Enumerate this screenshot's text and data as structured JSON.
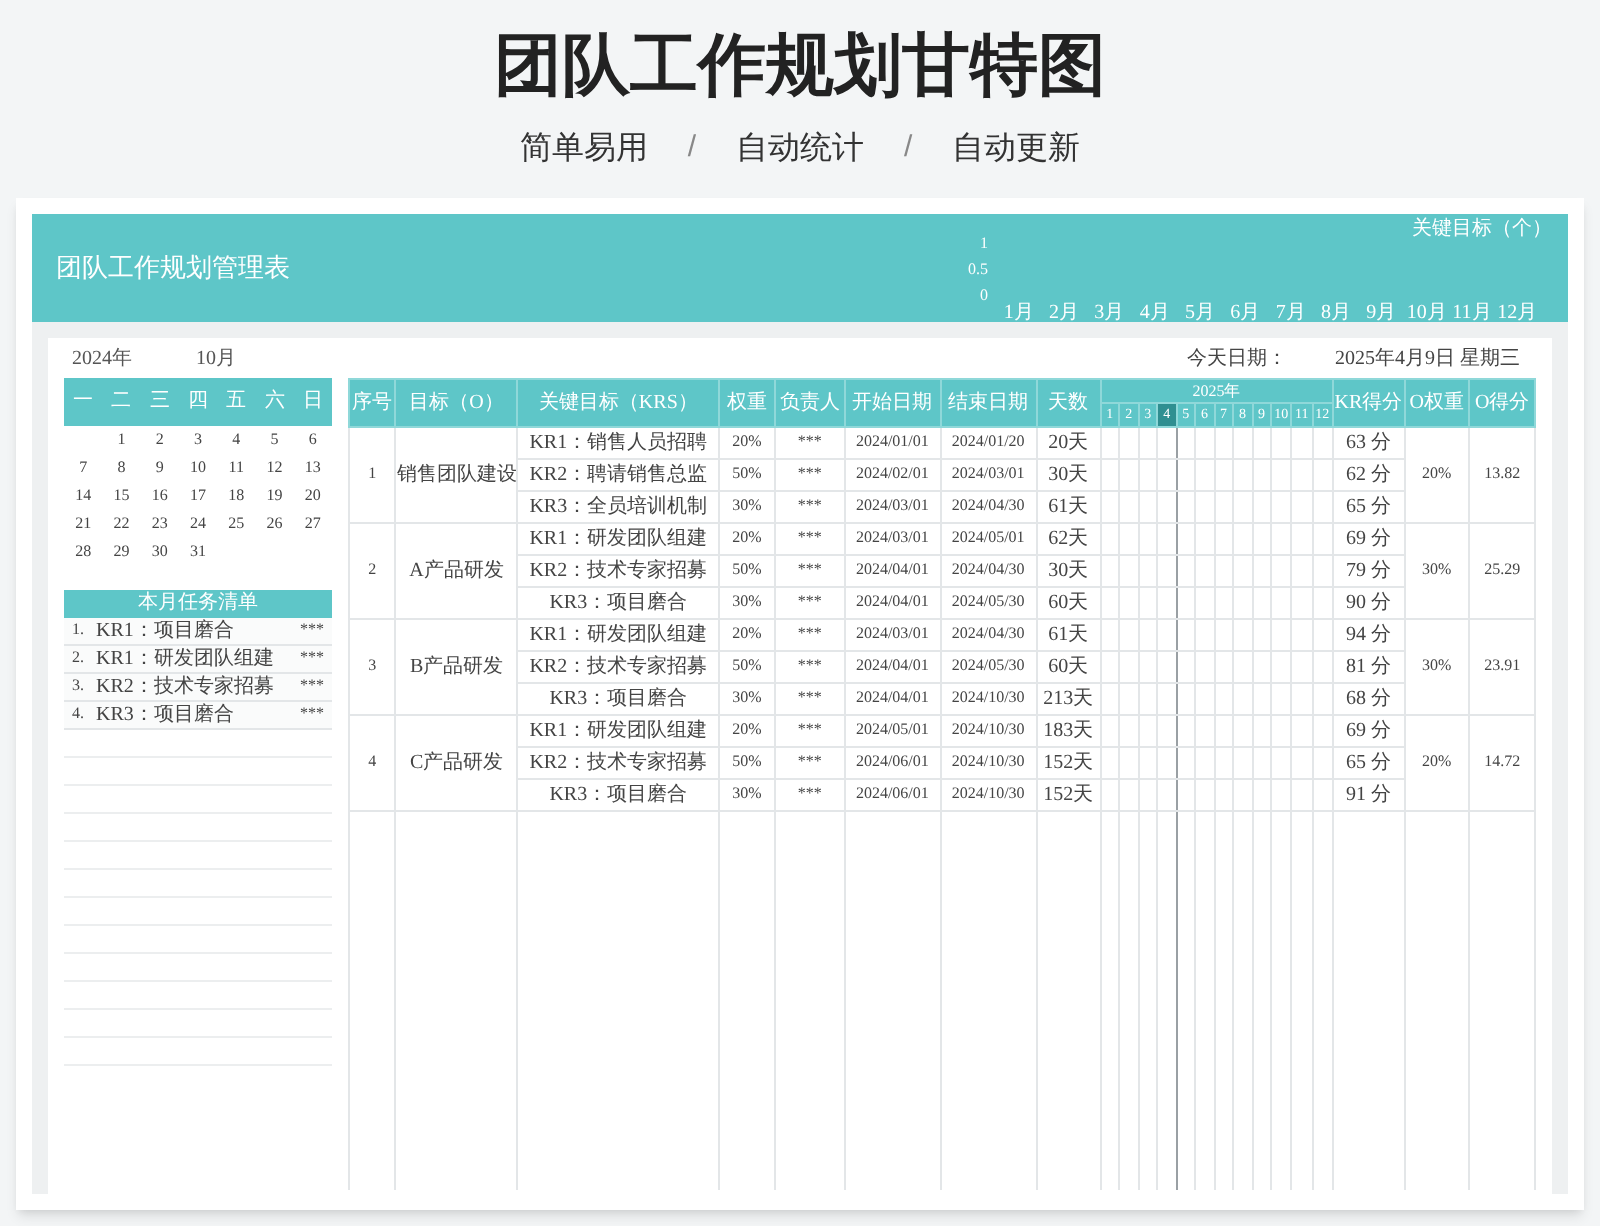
{
  "page_title": "团队工作规划甘特图",
  "subtitle": [
    {
      "kind": "text",
      "text": "简单易用"
    },
    {
      "kind": "sep",
      "text": "/"
    },
    {
      "kind": "text",
      "text": "自动统计"
    },
    {
      "kind": "sep",
      "text": "/"
    },
    {
      "kind": "text",
      "text": "自动更新"
    }
  ],
  "sheet": {
    "title": "团队工作规划管理表",
    "chart_data": {
      "type": "line",
      "title": "关键目标（个）",
      "categories": [
        "1月",
        "2月",
        "3月",
        "4月",
        "5月",
        "6月",
        "7月",
        "8月",
        "9月",
        "10月",
        "11月",
        "12月"
      ],
      "ylim": [
        0,
        1
      ],
      "yticks": [
        0,
        0.5,
        1
      ]
    }
  },
  "calendar": {
    "year": "2024年",
    "month": "10月",
    "weekdays": [
      "一",
      "二",
      "三",
      "四",
      "五",
      "六",
      "日"
    ],
    "weeks": [
      [
        "1",
        "2",
        "3",
        "4",
        "5",
        "6"
      ],
      [
        "7",
        "8",
        "9",
        "10",
        "11",
        "12",
        "13"
      ],
      [
        "14",
        "15",
        "16",
        "17",
        "18",
        "19",
        "20"
      ],
      [
        "21",
        "22",
        "23",
        "24",
        "25",
        "26",
        "27"
      ],
      [
        "28",
        "29",
        "30",
        "31"
      ]
    ]
  },
  "todo": {
    "title": "本月任务清单",
    "items": [
      {
        "index": "1.",
        "text": "KR1：项目磨合",
        "owner": "***"
      },
      {
        "index": "2.",
        "text": "KR1：研发团队组建",
        "owner": "***"
      },
      {
        "index": "3.",
        "text": "KR2：技术专家招募",
        "owner": "***"
      },
      {
        "index": "4.",
        "text": "KR3：项目磨合",
        "owner": "***"
      }
    ]
  },
  "today": {
    "label": "今天日期：",
    "value": "2025年4月9日 星期三"
  },
  "table": {
    "columns_left": [
      "序号",
      "目标（O）",
      "关键目标（KRS）",
      "权重",
      "负责人",
      "开始日期",
      "结束日期",
      "天数"
    ],
    "gantt": {
      "year": "2025年",
      "months": [
        {
          "label": "1",
          "selected": false
        },
        {
          "label": "2",
          "selected": false
        },
        {
          "label": "3",
          "selected": false
        },
        {
          "label": "4",
          "selected": true
        },
        {
          "label": "5",
          "selected": false
        },
        {
          "label": "6",
          "selected": false
        },
        {
          "label": "7",
          "selected": false
        },
        {
          "label": "8",
          "selected": false
        },
        {
          "label": "9",
          "selected": false
        },
        {
          "label": "10",
          "selected": false
        },
        {
          "label": "11",
          "selected": false
        },
        {
          "label": "12",
          "selected": false
        }
      ]
    },
    "columns_right": [
      "KR得分",
      "O权重",
      "O得分"
    ],
    "groups": [
      {
        "no": "1",
        "objective": "销售团队建设",
        "o_weight": "20%",
        "o_score": "13.82",
        "krs": [
          {
            "kr": "KR1：销售人员招聘",
            "weight": "20%",
            "owner": "***",
            "start": "2024/01/01",
            "end": "2024/01/20",
            "days": "20天",
            "score": "63 分"
          },
          {
            "kr": "KR2：聘请销售总监",
            "weight": "50%",
            "owner": "***",
            "start": "2024/02/01",
            "end": "2024/03/01",
            "days": "30天",
            "score": "62 分"
          },
          {
            "kr": "KR3：全员培训机制",
            "weight": "30%",
            "owner": "***",
            "start": "2024/03/01",
            "end": "2024/04/30",
            "days": "61天",
            "score": "65 分"
          }
        ]
      },
      {
        "no": "2",
        "objective": "A产品研发",
        "o_weight": "30%",
        "o_score": "25.29",
        "krs": [
          {
            "kr": "KR1：研发团队组建",
            "weight": "20%",
            "owner": "***",
            "start": "2024/03/01",
            "end": "2024/05/01",
            "days": "62天",
            "score": "69 分"
          },
          {
            "kr": "KR2：技术专家招募",
            "weight": "50%",
            "owner": "***",
            "start": "2024/04/01",
            "end": "2024/04/30",
            "days": "30天",
            "score": "79 分"
          },
          {
            "kr": "KR3：项目磨合",
            "weight": "30%",
            "owner": "***",
            "start": "2024/04/01",
            "end": "2024/05/30",
            "days": "60天",
            "score": "90 分"
          }
        ]
      },
      {
        "no": "3",
        "objective": "B产品研发",
        "o_weight": "30%",
        "o_score": "23.91",
        "krs": [
          {
            "kr": "KR1：研发团队组建",
            "weight": "20%",
            "owner": "***",
            "start": "2024/03/01",
            "end": "2024/04/30",
            "days": "61天",
            "score": "94 分"
          },
          {
            "kr": "KR2：技术专家招募",
            "weight": "50%",
            "owner": "***",
            "start": "2024/04/01",
            "end": "2024/05/30",
            "days": "60天",
            "score": "81 分"
          },
          {
            "kr": "KR3：项目磨合",
            "weight": "30%",
            "owner": "***",
            "start": "2024/04/01",
            "end": "2024/10/30",
            "days": "213天",
            "score": "68 分"
          }
        ]
      },
      {
        "no": "4",
        "objective": "C产品研发",
        "o_weight": "20%",
        "o_score": "14.72",
        "krs": [
          {
            "kr": "KR1：研发团队组建",
            "weight": "20%",
            "owner": "***",
            "start": "2024/05/01",
            "end": "2024/10/30",
            "days": "183天",
            "score": "69 分"
          },
          {
            "kr": "KR2：技术专家招募",
            "weight": "50%",
            "owner": "***",
            "start": "2024/06/01",
            "end": "2024/10/30",
            "days": "152天",
            "score": "65 分"
          },
          {
            "kr": "KR3：项目磨合",
            "weight": "30%",
            "owner": "***",
            "start": "2024/06/01",
            "end": "2024/10/30",
            "days": "152天",
            "score": "91 分"
          }
        ]
      }
    ]
  }
}
